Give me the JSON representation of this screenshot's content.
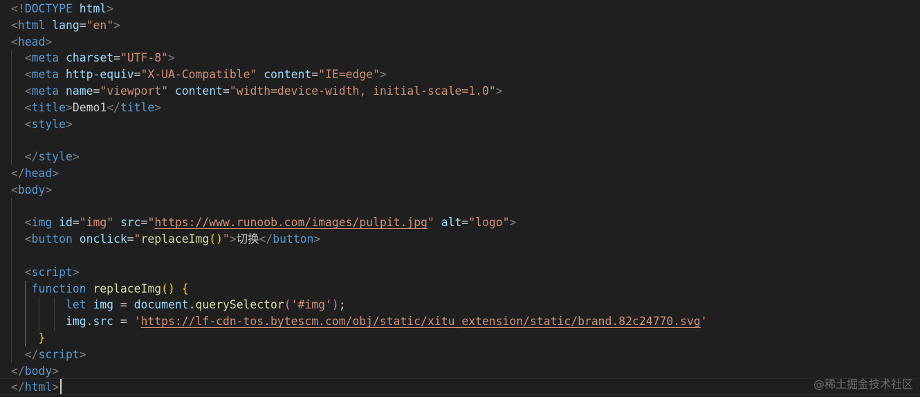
{
  "colors": {
    "background": "#1f1f1f",
    "tag": "#569cd6",
    "bracket": "#808080",
    "attr": "#9cdcfe",
    "string": "#ce9178",
    "text": "#cccccc",
    "keyword": "#569cd6",
    "function": "#dcdcaa",
    "brace1": "#ffd700",
    "brace2": "#da70d6",
    "variable": "#9cdcfe"
  },
  "editor": {
    "lines": [
      [
        {
          "t": "<!",
          "c": "bracket"
        },
        {
          "t": "DOCTYPE",
          "c": "tag"
        },
        {
          "t": " ",
          "c": "text"
        },
        {
          "t": "html",
          "c": "attr"
        },
        {
          "t": ">",
          "c": "bracket"
        }
      ],
      [
        {
          "t": "<",
          "c": "bracket"
        },
        {
          "t": "html",
          "c": "tag"
        },
        {
          "t": " ",
          "c": "text"
        },
        {
          "t": "lang",
          "c": "attr"
        },
        {
          "t": "=",
          "c": "text"
        },
        {
          "t": "\"en\"",
          "c": "string"
        },
        {
          "t": ">",
          "c": "bracket"
        }
      ],
      [
        {
          "t": "<",
          "c": "bracket"
        },
        {
          "t": "head",
          "c": "tag"
        },
        {
          "t": ">",
          "c": "bracket"
        }
      ],
      [
        {
          "t": "  ",
          "c": "text"
        },
        {
          "t": "<",
          "c": "bracket"
        },
        {
          "t": "meta",
          "c": "tag"
        },
        {
          "t": " ",
          "c": "text"
        },
        {
          "t": "charset",
          "c": "attr"
        },
        {
          "t": "=",
          "c": "text"
        },
        {
          "t": "\"UTF-8\"",
          "c": "string"
        },
        {
          "t": ">",
          "c": "bracket"
        }
      ],
      [
        {
          "t": "  ",
          "c": "text"
        },
        {
          "t": "<",
          "c": "bracket"
        },
        {
          "t": "meta",
          "c": "tag"
        },
        {
          "t": " ",
          "c": "text"
        },
        {
          "t": "http-equiv",
          "c": "attr"
        },
        {
          "t": "=",
          "c": "text"
        },
        {
          "t": "\"X-UA-Compatible\"",
          "c": "string"
        },
        {
          "t": " ",
          "c": "text"
        },
        {
          "t": "content",
          "c": "attr"
        },
        {
          "t": "=",
          "c": "text"
        },
        {
          "t": "\"IE=edge\"",
          "c": "string"
        },
        {
          "t": ">",
          "c": "bracket"
        }
      ],
      [
        {
          "t": "  ",
          "c": "text"
        },
        {
          "t": "<",
          "c": "bracket"
        },
        {
          "t": "meta",
          "c": "tag"
        },
        {
          "t": " ",
          "c": "text"
        },
        {
          "t": "name",
          "c": "attr"
        },
        {
          "t": "=",
          "c": "text"
        },
        {
          "t": "\"viewport\"",
          "c": "string"
        },
        {
          "t": " ",
          "c": "text"
        },
        {
          "t": "content",
          "c": "attr"
        },
        {
          "t": "=",
          "c": "text"
        },
        {
          "t": "\"width=device-width, initial-scale=1.0\"",
          "c": "string"
        },
        {
          "t": ">",
          "c": "bracket"
        }
      ],
      [
        {
          "t": "  ",
          "c": "text"
        },
        {
          "t": "<",
          "c": "bracket"
        },
        {
          "t": "title",
          "c": "tag"
        },
        {
          "t": ">",
          "c": "bracket"
        },
        {
          "t": "Demo1",
          "c": "text"
        },
        {
          "t": "</",
          "c": "bracket"
        },
        {
          "t": "title",
          "c": "tag"
        },
        {
          "t": ">",
          "c": "bracket"
        }
      ],
      [
        {
          "t": "  ",
          "c": "text"
        },
        {
          "t": "<",
          "c": "bracket"
        },
        {
          "t": "style",
          "c": "tag"
        },
        {
          "t": ">",
          "c": "bracket"
        }
      ],
      [
        {
          "t": "",
          "c": "text"
        }
      ],
      [
        {
          "t": "  ",
          "c": "text"
        },
        {
          "t": "</",
          "c": "bracket"
        },
        {
          "t": "style",
          "c": "tag"
        },
        {
          "t": ">",
          "c": "bracket"
        }
      ],
      [
        {
          "t": "</",
          "c": "bracket"
        },
        {
          "t": "head",
          "c": "tag"
        },
        {
          "t": ">",
          "c": "bracket"
        }
      ],
      [
        {
          "t": "<",
          "c": "bracket"
        },
        {
          "t": "body",
          "c": "tag"
        },
        {
          "t": ">",
          "c": "bracket"
        }
      ],
      [
        {
          "t": "",
          "c": "text"
        }
      ],
      [
        {
          "t": "  ",
          "c": "text"
        },
        {
          "t": "<",
          "c": "bracket"
        },
        {
          "t": "img",
          "c": "tag"
        },
        {
          "t": " ",
          "c": "text"
        },
        {
          "t": "id",
          "c": "attr"
        },
        {
          "t": "=",
          "c": "text"
        },
        {
          "t": "\"img\"",
          "c": "string"
        },
        {
          "t": " ",
          "c": "text"
        },
        {
          "t": "src",
          "c": "attr"
        },
        {
          "t": "=",
          "c": "text"
        },
        {
          "t": "\"",
          "c": "string"
        },
        {
          "t": "https://www.runoob.com/images/pulpit.jpg",
          "c": "string",
          "u": true
        },
        {
          "t": "\"",
          "c": "string"
        },
        {
          "t": " ",
          "c": "text"
        },
        {
          "t": "alt",
          "c": "attr"
        },
        {
          "t": "=",
          "c": "text"
        },
        {
          "t": "\"logo\"",
          "c": "string"
        },
        {
          "t": ">",
          "c": "bracket"
        }
      ],
      [
        {
          "t": "  ",
          "c": "text"
        },
        {
          "t": "<",
          "c": "bracket"
        },
        {
          "t": "button",
          "c": "tag"
        },
        {
          "t": " ",
          "c": "text"
        },
        {
          "t": "onclick",
          "c": "attr"
        },
        {
          "t": "=",
          "c": "text"
        },
        {
          "t": "\"",
          "c": "string"
        },
        {
          "t": "replaceImg",
          "c": "function"
        },
        {
          "t": "()",
          "c": "brace1"
        },
        {
          "t": "\"",
          "c": "string"
        },
        {
          "t": ">",
          "c": "bracket"
        },
        {
          "t": "切换",
          "c": "text"
        },
        {
          "t": "</",
          "c": "bracket"
        },
        {
          "t": "button",
          "c": "tag"
        },
        {
          "t": ">",
          "c": "bracket"
        }
      ],
      [
        {
          "t": "",
          "c": "text"
        }
      ],
      [
        {
          "t": "  ",
          "c": "text"
        },
        {
          "t": "<",
          "c": "bracket"
        },
        {
          "t": "script",
          "c": "tag"
        },
        {
          "t": ">",
          "c": "bracket"
        }
      ],
      [
        {
          "t": "   ",
          "c": "text"
        },
        {
          "t": "function",
          "c": "keyword"
        },
        {
          "t": " ",
          "c": "text"
        },
        {
          "t": "replaceImg",
          "c": "function"
        },
        {
          "t": "()",
          "c": "brace1"
        },
        {
          "t": " ",
          "c": "text"
        },
        {
          "t": "{",
          "c": "brace1"
        }
      ],
      [
        {
          "t": "        ",
          "c": "text"
        },
        {
          "t": "let",
          "c": "keyword"
        },
        {
          "t": " ",
          "c": "text"
        },
        {
          "t": "img",
          "c": "variable"
        },
        {
          "t": " = ",
          "c": "text"
        },
        {
          "t": "document",
          "c": "variable"
        },
        {
          "t": ".",
          "c": "text"
        },
        {
          "t": "querySelector",
          "c": "function"
        },
        {
          "t": "(",
          "c": "brace2"
        },
        {
          "t": "'#img'",
          "c": "string"
        },
        {
          "t": ")",
          "c": "brace2"
        },
        {
          "t": ";",
          "c": "text"
        }
      ],
      [
        {
          "t": "        ",
          "c": "text"
        },
        {
          "t": "img",
          "c": "variable"
        },
        {
          "t": ".",
          "c": "text"
        },
        {
          "t": "src",
          "c": "variable"
        },
        {
          "t": " = ",
          "c": "text"
        },
        {
          "t": "'",
          "c": "string"
        },
        {
          "t": "https://lf-cdn-tos.bytescm.com/obj/static/xitu_extension/static/brand.82c24770.svg",
          "c": "string",
          "u": true
        },
        {
          "t": "'",
          "c": "string"
        }
      ],
      [
        {
          "t": "    ",
          "c": "text"
        },
        {
          "t": "}",
          "c": "brace1"
        }
      ],
      [
        {
          "t": "  ",
          "c": "text"
        },
        {
          "t": "</",
          "c": "bracket"
        },
        {
          "t": "script",
          "c": "tag"
        },
        {
          "t": ">",
          "c": "bracket"
        }
      ],
      [
        {
          "t": "</",
          "c": "bracket"
        },
        {
          "t": "body",
          "c": "tag"
        },
        {
          "t": ">",
          "c": "bracket"
        }
      ],
      [
        {
          "t": "</",
          "c": "bracket"
        },
        {
          "t": "html",
          "c": "tag"
        },
        {
          "t": ">",
          "c": "bracket"
        }
      ]
    ]
  },
  "watermark": "@稀土掘金技术社区"
}
